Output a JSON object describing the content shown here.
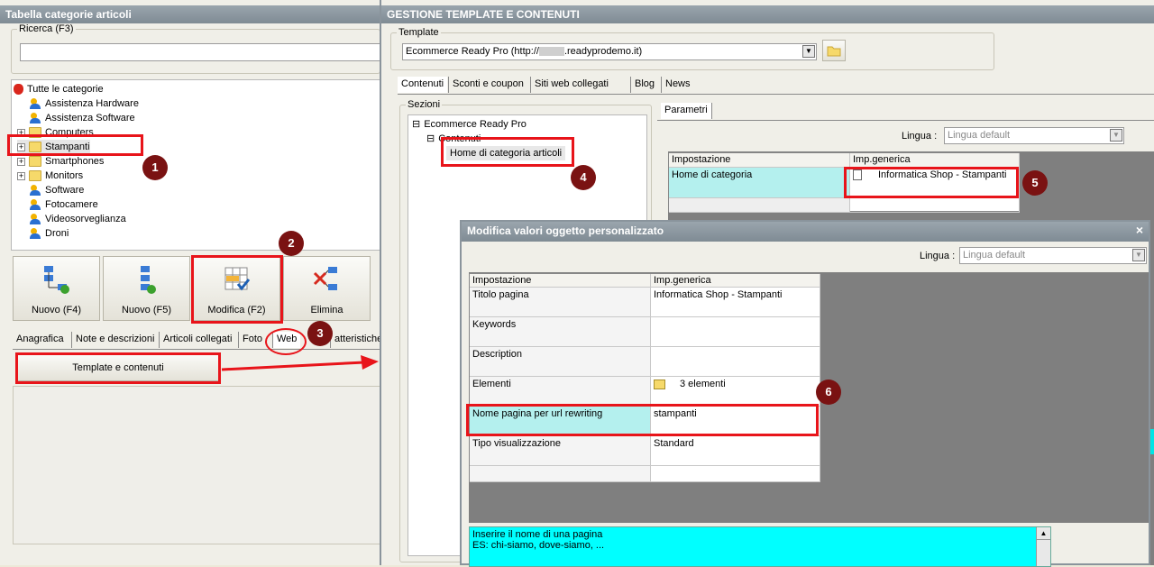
{
  "left": {
    "title": "Tabella categorie articoli",
    "search_label": "Ricerca (F3)",
    "tree": [
      {
        "label": "Tutte le categorie",
        "icon": "strawberry-icon",
        "indent": 0,
        "expander": false
      },
      {
        "label": "Assistenza Hardware",
        "icon": "user-icon",
        "indent": 1,
        "expander": false
      },
      {
        "label": "Assistenza Software",
        "icon": "user-icon",
        "indent": 1,
        "expander": false
      },
      {
        "label": "Computers",
        "icon": "folder-icon",
        "indent": 1,
        "expander": true
      },
      {
        "label": "Stampanti",
        "icon": "folder-icon",
        "indent": 1,
        "expander": true
      },
      {
        "label": "Smartphones",
        "icon": "folder-icon",
        "indent": 1,
        "expander": true
      },
      {
        "label": "Monitors",
        "icon": "folder-icon",
        "indent": 1,
        "expander": true
      },
      {
        "label": "Software",
        "icon": "user-icon",
        "indent": 1,
        "expander": false
      },
      {
        "label": "Fotocamere",
        "icon": "user-icon",
        "indent": 1,
        "expander": false
      },
      {
        "label": "Videosorveglianza",
        "icon": "user-icon",
        "indent": 1,
        "expander": false
      },
      {
        "label": "Droni",
        "icon": "user-icon",
        "indent": 1,
        "expander": false
      }
    ],
    "buttons": {
      "nuovo_f4": "Nuovo (F4)",
      "nuovo_f5": "Nuovo (F5)",
      "modifica": "Modifica (F2)",
      "elimina": "Elimina"
    },
    "tabs": [
      "Anagrafica",
      "Note e descrizioni",
      "Articoli collegati",
      "Foto",
      "Web",
      "atteristiche"
    ],
    "template_button": "Template e contenuti"
  },
  "right": {
    "title": "GESTIONE TEMPLATE E CONTENUTI",
    "template_label": "Template",
    "template_value_prefix": "Ecommerce Ready Pro (http://",
    "template_value_suffix": ".readyprodemo.it)",
    "tabs": [
      "Contenuti",
      "Sconti e coupon",
      "Siti web collegati",
      "Blog",
      "News"
    ],
    "sezioni_label": "Sezioni",
    "tree": {
      "root": "Ecommerce Ready Pro",
      "child": "Contenuti",
      "leaf": "Home di categoria articoli"
    },
    "parametri_tab": "Parametri",
    "lingua_label": "Lingua :",
    "lingua_value": "Lingua default",
    "grid": {
      "col1": "Impostazione",
      "col2": "Imp.generica",
      "row_setting": "Home di categoria",
      "row_value": "Informatica Shop - Stampanti"
    }
  },
  "dialog": {
    "title": "Modifica valori oggetto personalizzato",
    "close": "×",
    "lingua_label": "Lingua :",
    "lingua_value": "Lingua default",
    "col1": "Impostazione",
    "col2": "Imp.generica",
    "rows": [
      {
        "setting": "Titolo pagina",
        "value": "Informatica Shop - Stampanti"
      },
      {
        "setting": "Keywords",
        "value": ""
      },
      {
        "setting": "Description",
        "value": ""
      },
      {
        "setting": "Elementi",
        "value": "3 elementi"
      },
      {
        "setting": "Nome pagina per url rewriting",
        "value": "stampanti"
      },
      {
        "setting": "Tipo visualizzazione",
        "value": "Standard"
      }
    ],
    "hint_line1": "Inserire il nome di una pagina",
    "hint_line2": "ES: chi-siamo, dove-siamo, ..."
  },
  "annotations": [
    "1",
    "2",
    "3",
    "4",
    "5",
    "6"
  ],
  "colors": {
    "highlight_red": "#e8141a",
    "badge": "#7a1212",
    "selected_cyan": "#b4f0ee",
    "hint_cyan": "#00ffff"
  }
}
